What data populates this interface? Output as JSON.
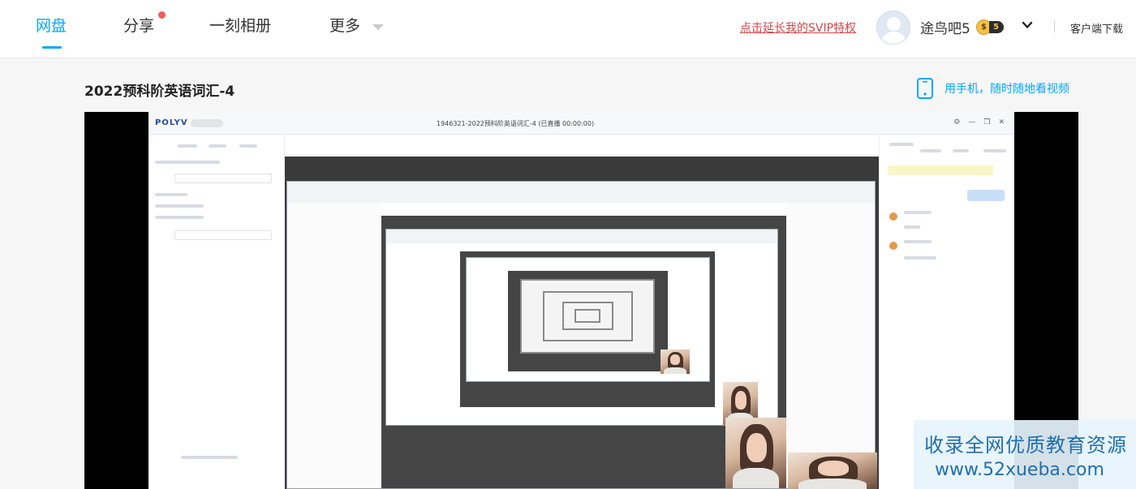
{
  "nav": {
    "items": [
      {
        "label": "网盘"
      },
      {
        "label": "分享"
      },
      {
        "label": "一刻相册"
      },
      {
        "label": "更多"
      }
    ],
    "accent_color": "#06a7ff",
    "notification_dot_color": "#f25d5d"
  },
  "user": {
    "svip_link": "点击延长我的SVIP特权",
    "name": "途鸟吧5",
    "vip_coin": "$",
    "vip_level": "5",
    "client_download": "客户端下载"
  },
  "page": {
    "title": "2022预科阶英语词汇-4",
    "mobile_link": "用手机，随时随地看视频"
  },
  "video": {
    "screen_app_logo": "POLYV",
    "screen_title": "1946321-2022预科阶英语词汇-4   (已直播 00:00:00)"
  },
  "watermark": {
    "line1": "收录全网优质教育资源",
    "line2": "www.52xueba.com"
  }
}
